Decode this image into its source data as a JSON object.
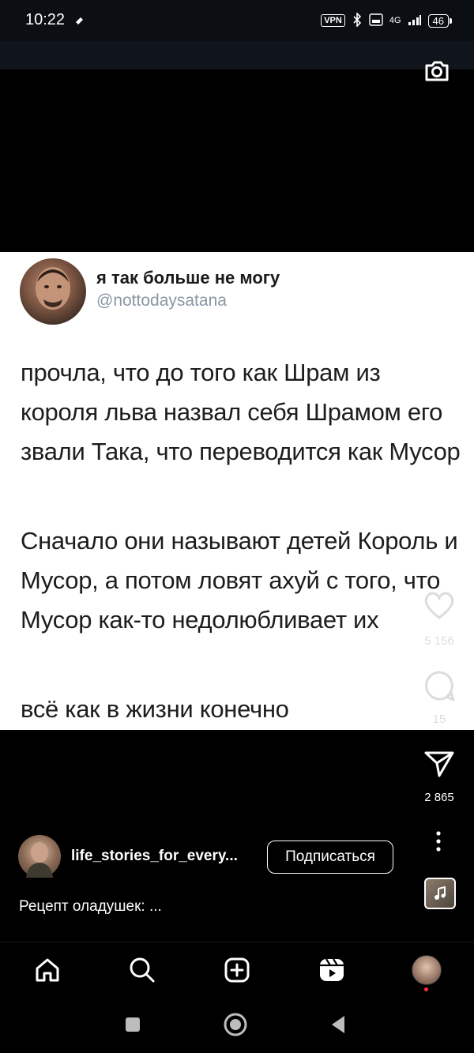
{
  "status_bar": {
    "time": "10:22",
    "vpn": "VPN",
    "network": "4G",
    "battery": "46"
  },
  "tweet": {
    "author_name": "я так больше не могу",
    "author_handle": "@nottodaysatana",
    "paragraphs": [
      "прочла, что до того как Шрам из короля льва назвал себя Шрамом его звали Така, что переводится как Мусор",
      "Сначало они называют детей Король и Мусор, а потом ловят ахуй с того, что Мусор как-то недолюбливает их",
      "всё как в жизни конечно"
    ]
  },
  "actions": {
    "likes": "5 156",
    "comments": "15",
    "shares": "2 865"
  },
  "post": {
    "author": "life_stories_for_every...",
    "subscribe_label": "Подписаться",
    "caption": "Рецепт оладушек: ..."
  },
  "icons": {
    "camera": "camera-icon",
    "heart": "heart-icon",
    "comment": "comment-icon",
    "share": "share-icon",
    "more": "more-vertical-icon",
    "music": "music-icon",
    "home": "home-icon",
    "search": "search-icon",
    "create": "create-icon",
    "reels": "reels-icon",
    "profile": "profile-avatar"
  },
  "colors": {
    "background": "#000000",
    "card": "#ffffff",
    "handle": "#8a96a3",
    "notification_dot": "#ff3040"
  }
}
